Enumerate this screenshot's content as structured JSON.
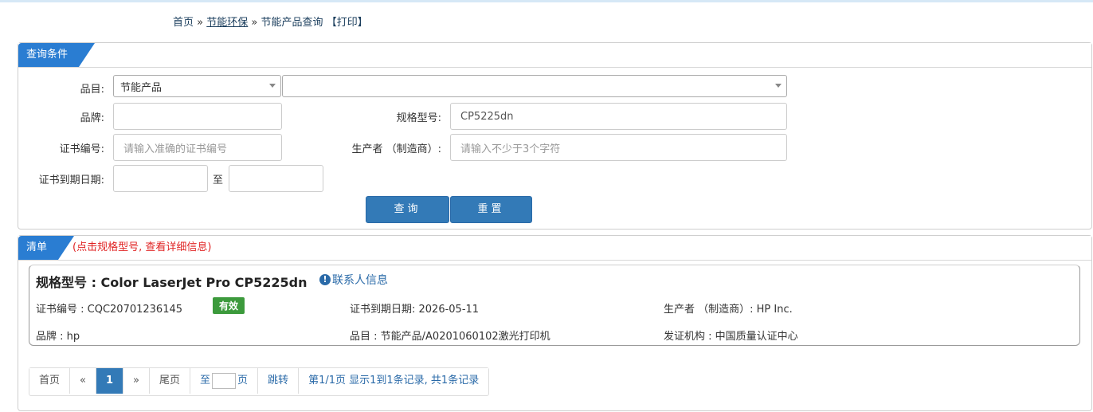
{
  "breadcrumb": {
    "home": "首页",
    "sep1": "»",
    "section": "节能环保",
    "sep2": "»",
    "current": "节能产品查询",
    "print": "【打印】"
  },
  "query_panel": {
    "title": "查询条件",
    "category_label": "品目:",
    "category_value": "节能产品",
    "subcategory_value": "",
    "brand_label": "品牌:",
    "brand_value": "",
    "model_label": "规格型号:",
    "model_value": "CP5225dn",
    "cert_label": "证书编号:",
    "cert_placeholder": "请输入准确的证书编号",
    "maker_label": "生产者 （制造商）:",
    "maker_placeholder": "请输入不少于3个字符",
    "expiry_label": "证书到期日期:",
    "expiry_from": "",
    "expiry_to_label": "至",
    "expiry_to": "",
    "search_button": "查询",
    "reset_button": "重置"
  },
  "list_panel": {
    "title": "清单",
    "hint": "(点击规格型号, 查看详细信息)"
  },
  "result": {
    "title": "规格型号 : Color LaserJet Pro CP5225dn",
    "contact_link": "联系人信息",
    "cert_no": "证书编号 : CQC20701236145",
    "status": "有效",
    "expiry": "证书到期日期: 2026-05-11",
    "maker": "生产者 （制造商）: HP Inc.",
    "brand": "品牌 : hp",
    "category": "品目 : 节能产品/A0201060102激光打印机",
    "issuer": "发证机构 : 中国质量认证中心"
  },
  "pager": {
    "first": "首页",
    "prev": "«",
    "current": "1",
    "next": "»",
    "last": "尾页",
    "goto_prefix": "至",
    "goto_suffix": "页",
    "jump": "跳转",
    "summary": "第1/1页  显示1到1条记录, 共1条记录"
  },
  "colors": {
    "accent": "#337ab7",
    "tab_blue": "#2a7dd2",
    "hint_red": "#e02424",
    "valid_green": "#3c9a3c"
  }
}
